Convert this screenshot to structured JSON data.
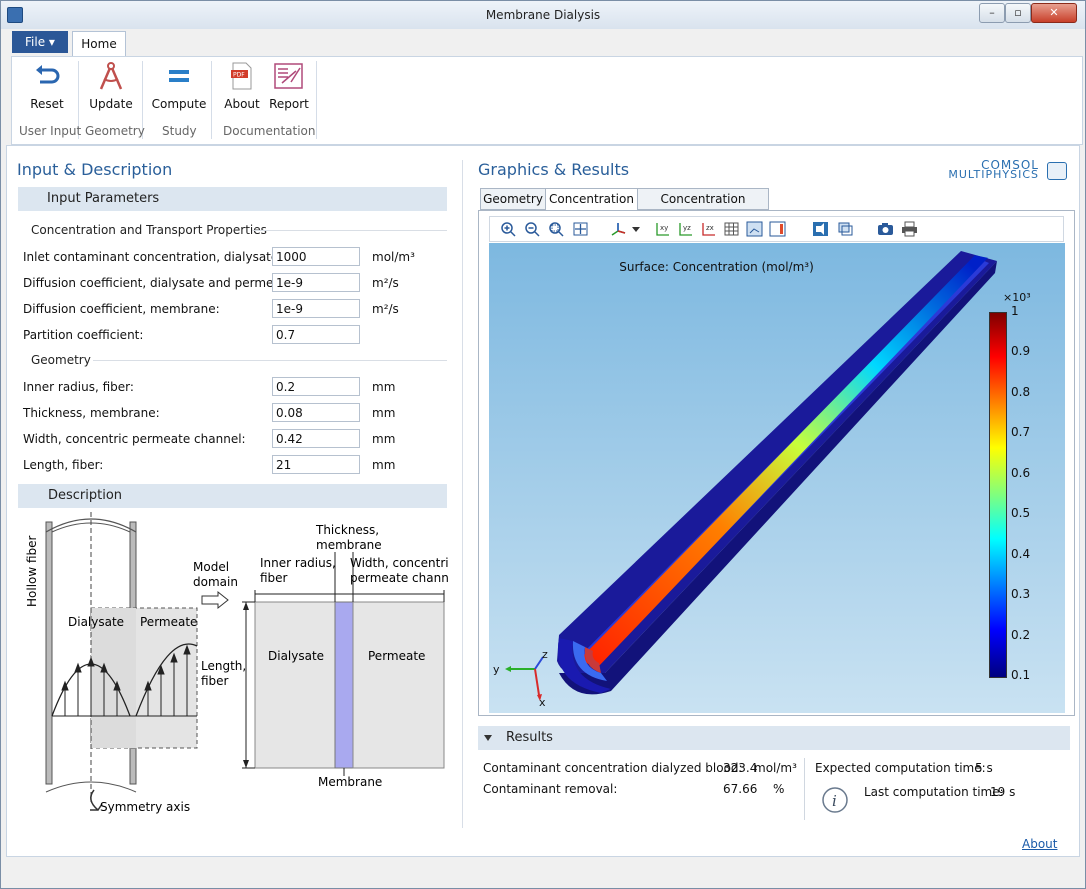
{
  "window": {
    "title": "Membrane Dialysis"
  },
  "ribbon": {
    "file_label": "File ▾",
    "home_tab": "Home",
    "buttons": {
      "reset": "Reset",
      "update": "Update",
      "compute": "Compute",
      "about": "About",
      "report": "Report"
    },
    "groups": {
      "user_input": "User Input",
      "geometry": "Geometry",
      "study": "Study",
      "documentation": "Documentation"
    }
  },
  "left": {
    "title": "Input & Description",
    "input_parameters": "Input Parameters",
    "conc_section": "Concentration and Transport Properties",
    "geom_section": "Geometry",
    "params": [
      {
        "label": "Inlet contaminant concentration, dialysate:",
        "value": "1000",
        "unit": "mol/m³"
      },
      {
        "label": "Diffusion coefficient, dialysate and permeate:",
        "value": "1e-9",
        "unit": "m²/s"
      },
      {
        "label": "Diffusion coefficient, membrane:",
        "value": "1e-9",
        "unit": "m²/s"
      },
      {
        "label": "Partition coefficient:",
        "value": "0.7",
        "unit": ""
      },
      {
        "label": "Inner radius, fiber:",
        "value": "0.2",
        "unit": "mm"
      },
      {
        "label": "Thickness, membrane:",
        "value": "0.08",
        "unit": "mm"
      },
      {
        "label": "Width, concentric permeate channel:",
        "value": "0.42",
        "unit": "mm"
      },
      {
        "label": "Length, fiber:",
        "value": "21",
        "unit": "mm"
      }
    ],
    "description": "Description",
    "diagram": {
      "hollow_fiber": "Hollow fiber",
      "dialysate": "Dialysate",
      "permeate": "Permeate",
      "length_fiber_1": "Length,",
      "length_fiber_2": "fiber",
      "symmetry_axis": "Symmetry axis",
      "model_domain_1": "Model",
      "model_domain_2": "domain",
      "inner_radius_1": "Inner radius,",
      "inner_radius_2": "fiber",
      "thickness_1": "Thickness,",
      "thickness_2": "membrane",
      "width_1": "Width, concentric",
      "width_2": "permeate channel",
      "dialysate2": "Dialysate",
      "permeate2": "Permeate",
      "membrane": "Membrane"
    }
  },
  "right": {
    "title": "Graphics & Results",
    "logo_1": "COMSOL",
    "logo_2": "MULTIPHYSICS",
    "tabs": [
      "Geometry",
      "Concentration",
      "Concentration Profiles"
    ],
    "plot_title": "Surface: Concentration (mol/m³)",
    "colorbar_exp": "×10³",
    "colorbar_ticks": [
      "1",
      "0.9",
      "0.8",
      "0.7",
      "0.6",
      "0.5",
      "0.4",
      "0.3",
      "0.2",
      "0.1"
    ],
    "axes": {
      "x": "x",
      "y": "y",
      "z": "z"
    },
    "results_title": "Results",
    "results": {
      "conc_label": "Contaminant concentration dialyzed blood:",
      "conc_value": "323.4",
      "conc_unit": "mol/m³",
      "removal_label": "Contaminant removal:",
      "removal_value": "67.66",
      "removal_unit": "%",
      "expected_label": "Expected computation time:",
      "expected_value": "5 s",
      "last_label": "Last computation time:",
      "last_value": "19 s"
    },
    "about_link": "About"
  }
}
